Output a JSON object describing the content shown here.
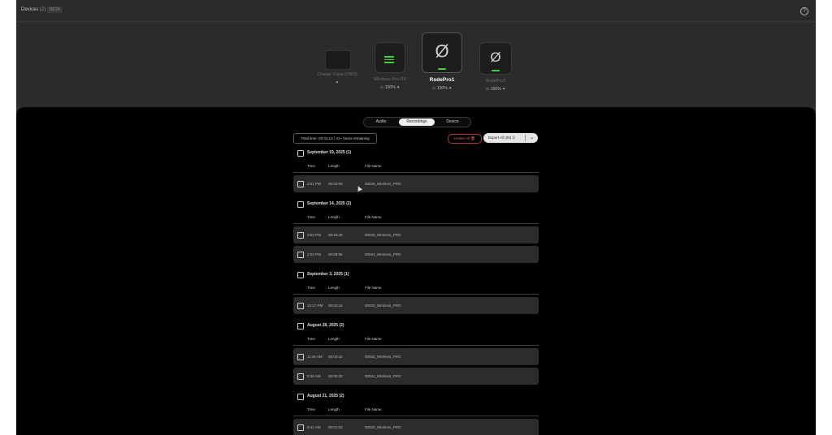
{
  "header": {
    "title": "Devices",
    "count": "(2)",
    "version": "BETA",
    "help_icon": "help-icon"
  },
  "devices": [
    {
      "name": "Charge Case (PRO)",
      "status": "",
      "selected": false
    },
    {
      "name": "Wireless Pro RX",
      "status": "100%",
      "selected": false
    },
    {
      "name": "RodePro1",
      "status": "100%",
      "selected": true
    },
    {
      "name": "RodePro2",
      "status": "100%",
      "selected": false
    }
  ],
  "tabs": [
    {
      "label": "Audio",
      "active": false
    },
    {
      "label": "Recordings",
      "active": true
    },
    {
      "label": "Device",
      "active": false
    }
  ],
  "toolbar": {
    "total_time": "Total time: 03:41:13 / 41+ hours remaining",
    "delete_label": "Delete All",
    "export_label": "Export All (25)"
  },
  "columns": {
    "time": "Time",
    "length": "Length",
    "file_name": "File Name"
  },
  "groups": [
    {
      "title": "September 19, 2025 (1)",
      "rows": [
        {
          "time": "3:01 PM",
          "length": "00:02:09",
          "file": "00026_Wireless_PRO"
        }
      ]
    },
    {
      "title": "September 14, 2025 (2)",
      "rows": [
        {
          "time": "3:53 PM",
          "length": "00:18:49",
          "file": "00025_Wireless_PRO"
        },
        {
          "time": "2:53 PM",
          "length": "00:08:56",
          "file": "00024_Wireless_PRO"
        }
      ]
    },
    {
      "title": "September 3, 2025 (1)",
      "rows": [
        {
          "time": "12:17 PM",
          "length": "00:02:24",
          "file": "00023_Wireless_PRO"
        }
      ]
    },
    {
      "title": "August 28, 2025 (2)",
      "rows": [
        {
          "time": "11:46 AM",
          "length": "00:03:42",
          "file": "00022_Wireless_PRO"
        },
        {
          "time": "8:26 AM",
          "length": "00:05:20",
          "file": "00021_Wireless_PRO"
        }
      ]
    },
    {
      "title": "August 21, 2025 (2)",
      "rows": [
        {
          "time": "9:41 AM",
          "length": "00:01:03",
          "file": "00020_Wireless_PRO"
        }
      ]
    }
  ],
  "colors": {
    "accent_green": "#3fd13a",
    "danger": "#b23a3a",
    "panel": "#2b2b2b",
    "background": "#000000"
  }
}
